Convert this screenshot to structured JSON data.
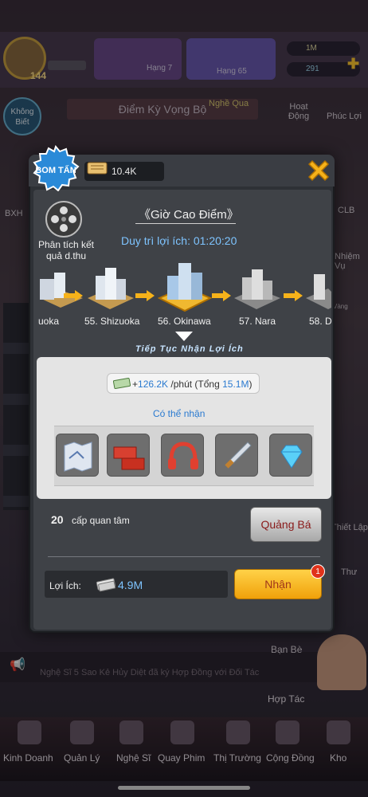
{
  "background": {
    "player_level": "144",
    "rank_left": "Hạng 7",
    "rank_right": "Hạng 65",
    "resource_1": "1M",
    "resource_2": "291",
    "side_left_circle": "Không Biết",
    "expectation_bar": "Điểm Kỳ Vọng Bộ",
    "profession_label": "Nghề Qua",
    "activity": "Hoạt Động",
    "welfare": "Phúc Lợi",
    "ranking": "BXH",
    "club": "CLB",
    "mission": "Nhiệm Vụ",
    "gold": "Vàng",
    "setting": "Thiết Lập",
    "mail": "Thư",
    "ticker": "Nghệ Sĩ 5 Sao Kẻ Hủy Diệt đã ký Hợp Đồng với Đối Tác",
    "friends": "Bạn Bè",
    "cooperation": "Hợp Tác",
    "nav": [
      "Kinh Doanh",
      "Quản Lý",
      "Nghệ Sĩ",
      "Quay Phim",
      "Thị Trường",
      "Cộng Đồng",
      "Kho"
    ]
  },
  "dialog": {
    "badge_text": "BOM TẤN",
    "currency_value": "10.4K",
    "side_label": "Phân tích kết quả d.thu",
    "event_title": "《Giờ Cao Điểm》",
    "duration": "Duy trì lợi ích: 01:20:20",
    "cities": [
      {
        "label": "uoka",
        "state": "done"
      },
      {
        "label": "55. Shizuoka",
        "state": "done"
      },
      {
        "label": "56. Okinawa",
        "state": "current"
      },
      {
        "label": "57. Nara",
        "state": "locked"
      },
      {
        "label": "58. D",
        "state": "locked"
      }
    ],
    "next_label": "Tiếp Tục Nhận Lợi Ích",
    "rate_prefix": "+",
    "rate_value": "126.2K",
    "rate_unit": " /phút (Tổng ",
    "rate_total": "15.1M",
    "rate_suffix": ")",
    "can_receive": "Có thể nhận",
    "items": [
      "map-item",
      "brick-item",
      "headphones-item",
      "dagger-item",
      "diamond-item"
    ],
    "care_level": "20",
    "care_text": "cấp quan tâm",
    "promote_button": "Quảng Bá",
    "benefit_label": "Lợi Ích:",
    "benefit_value": "4.9M",
    "receive_button": "Nhận",
    "receive_badge": "1"
  },
  "colors": {
    "accent_blue": "#7ec4ff",
    "button_gold": "#f0a10a",
    "badge_red": "#e0321a"
  }
}
